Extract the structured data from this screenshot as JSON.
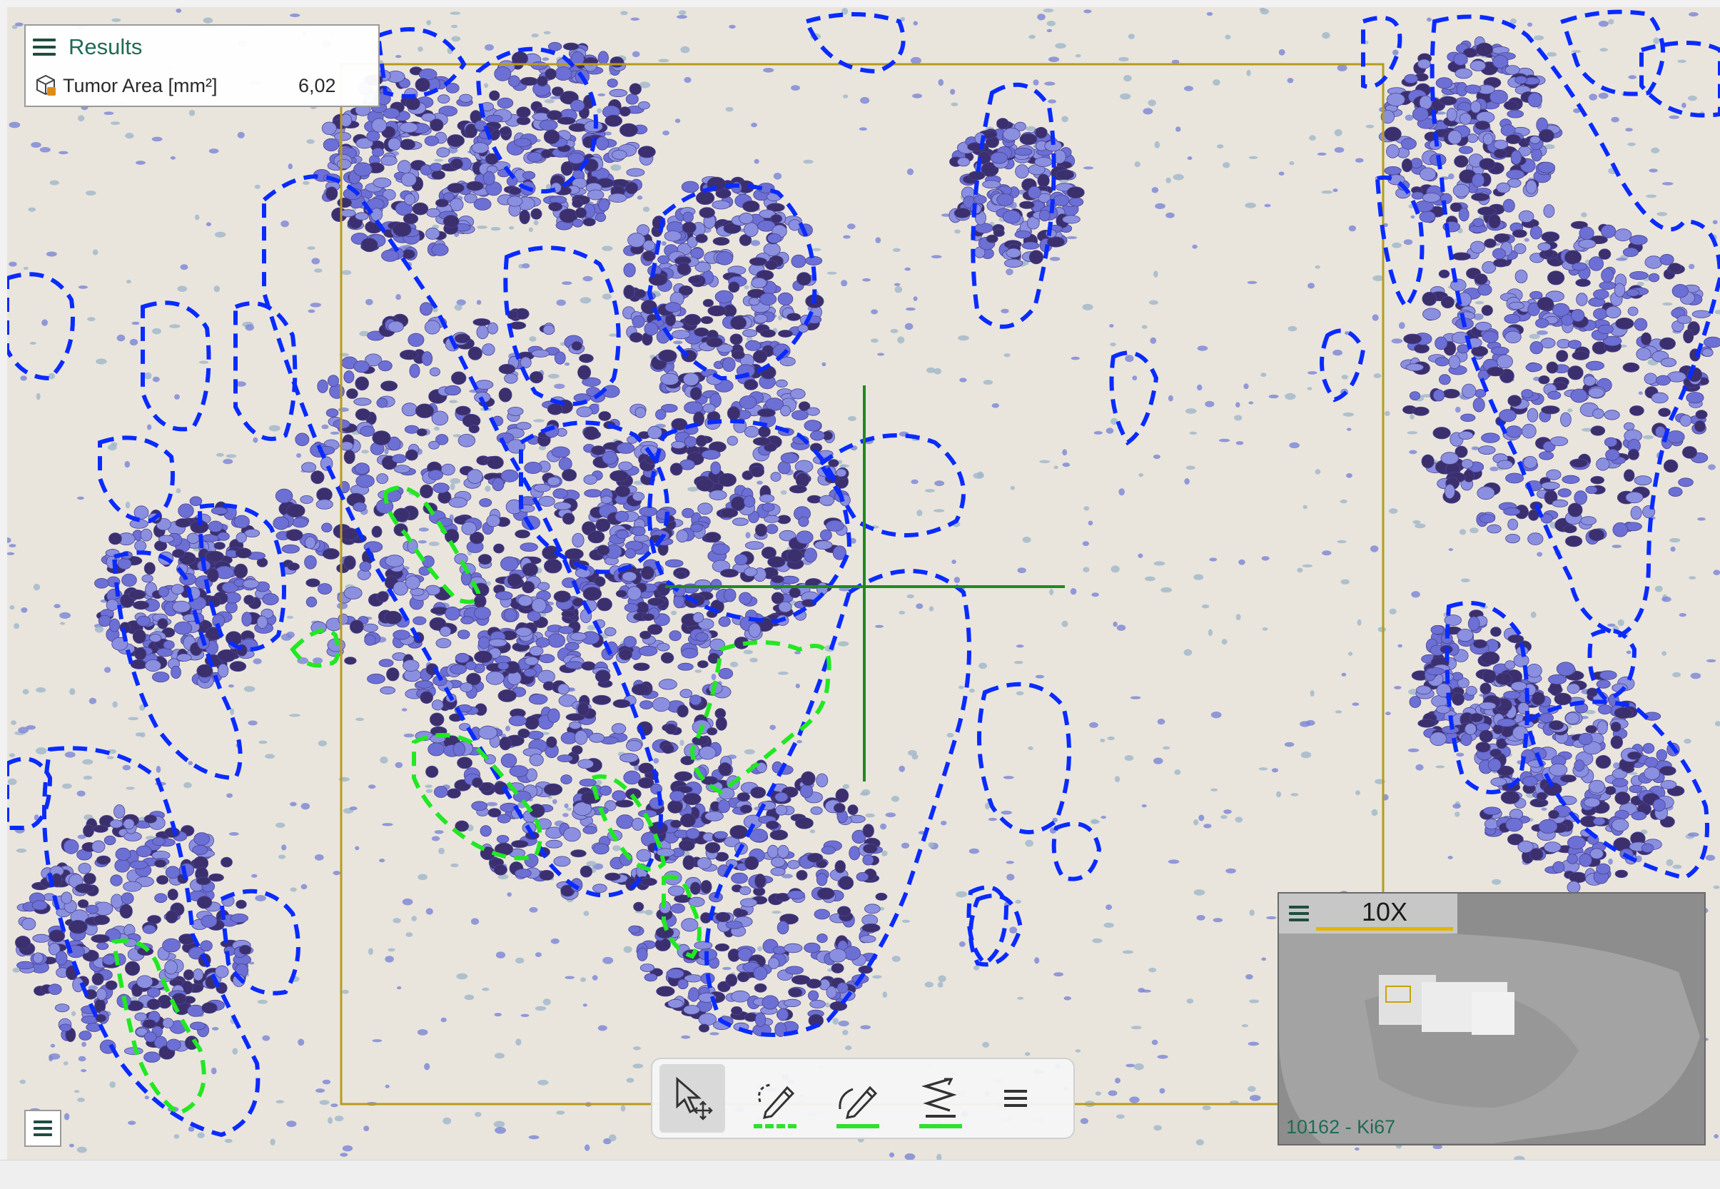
{
  "results": {
    "title": "Results",
    "metric_label": "Tumor Area [mm²]",
    "metric_value": "6,02"
  },
  "overview": {
    "zoom_label": "10X",
    "slide_label": "10162 - Ki67"
  },
  "toolbar": {
    "tools": [
      "select-move",
      "draw-dashed",
      "draw-solid",
      "draw-path"
    ]
  },
  "colors": {
    "tumor_outline": "#0a2bff",
    "exclusion_outline": "#22e822",
    "roi_frame": "#b89a1c",
    "crosshair": "#1f8a1f",
    "accent_text": "#1f6b55"
  }
}
